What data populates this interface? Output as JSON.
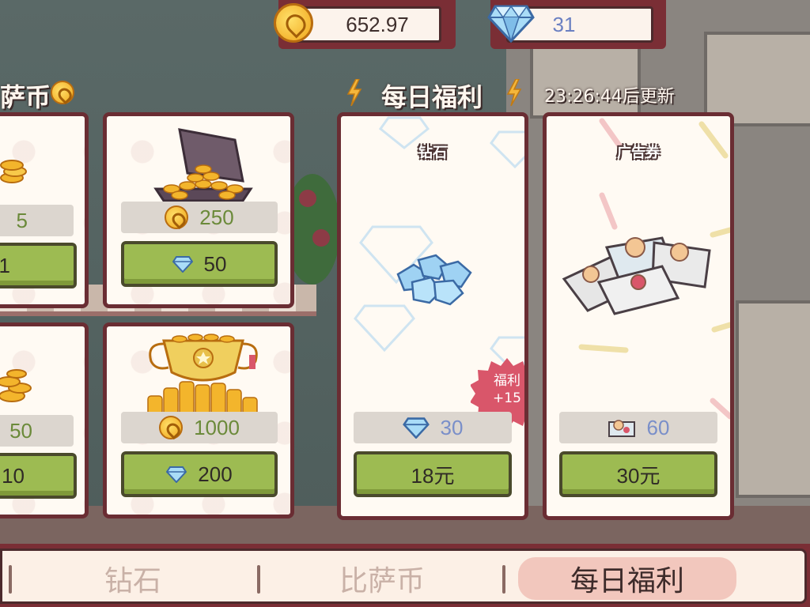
{
  "resources": {
    "coins": "652.97",
    "gems": "31"
  },
  "headers": {
    "coins_title_partial": "萨币",
    "daily_title": "每日福利",
    "refresh_timer": "23:26:44后更新"
  },
  "coin_packs": [
    {
      "amount": "5",
      "price": "1",
      "partial": true
    },
    {
      "amount": "250",
      "price": "50",
      "partial": false
    },
    {
      "amount": "50",
      "price": "10",
      "partial": true
    },
    {
      "amount": "1000",
      "price": "200",
      "partial": false
    }
  ],
  "daily_offers": [
    {
      "title": "钻石",
      "amount": "30",
      "price": "18元",
      "icon": "gem-icon",
      "badge": {
        "line1": "福利",
        "line2": "+15"
      }
    },
    {
      "title": "广告券",
      "amount": "60",
      "price": "30元",
      "icon": "ad-ticket-icon"
    }
  ],
  "tabs": [
    "钻石",
    "比萨币",
    "每日福利"
  ],
  "active_tab": "每日福利",
  "colors": {
    "frame": "#7a2e35",
    "button_green": "#9dbb52",
    "coin_text": "#6b8a3a",
    "gem_text": "#7a8fc9",
    "badge": "#d9566a",
    "tab_active": "#f2c7bd"
  }
}
